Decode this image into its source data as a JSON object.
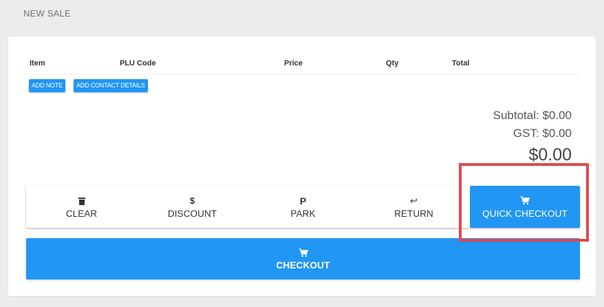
{
  "page": {
    "title": "NEW SALE"
  },
  "table": {
    "columns": [
      "Item",
      "PLU Code",
      "Price",
      "Qty",
      "Total"
    ]
  },
  "buttons": {
    "add_note": "ADD NOTE",
    "add_contact": "ADD CONTACT DETAILS"
  },
  "totals": {
    "subtotal_label": "Subtotal:",
    "subtotal_value": "$0.00",
    "gst_label": "GST:",
    "gst_value": "$0.00",
    "grand_total": "$0.00"
  },
  "actions": [
    {
      "key": "clear",
      "label": "CLEAR",
      "icon": "trash-icon"
    },
    {
      "key": "discount",
      "label": "DISCOUNT",
      "icon": "$"
    },
    {
      "key": "park",
      "label": "PARK",
      "icon": "P"
    },
    {
      "key": "return",
      "label": "RETURN",
      "icon": "↩"
    },
    {
      "key": "quick_checkout",
      "label": "QUICK CHECKOUT",
      "icon": "cart-icon"
    }
  ],
  "checkout": {
    "label": "CHECKOUT",
    "icon": "cart-icon"
  },
  "colors": {
    "primary": "#2196f3",
    "highlight": "#e0474c"
  }
}
